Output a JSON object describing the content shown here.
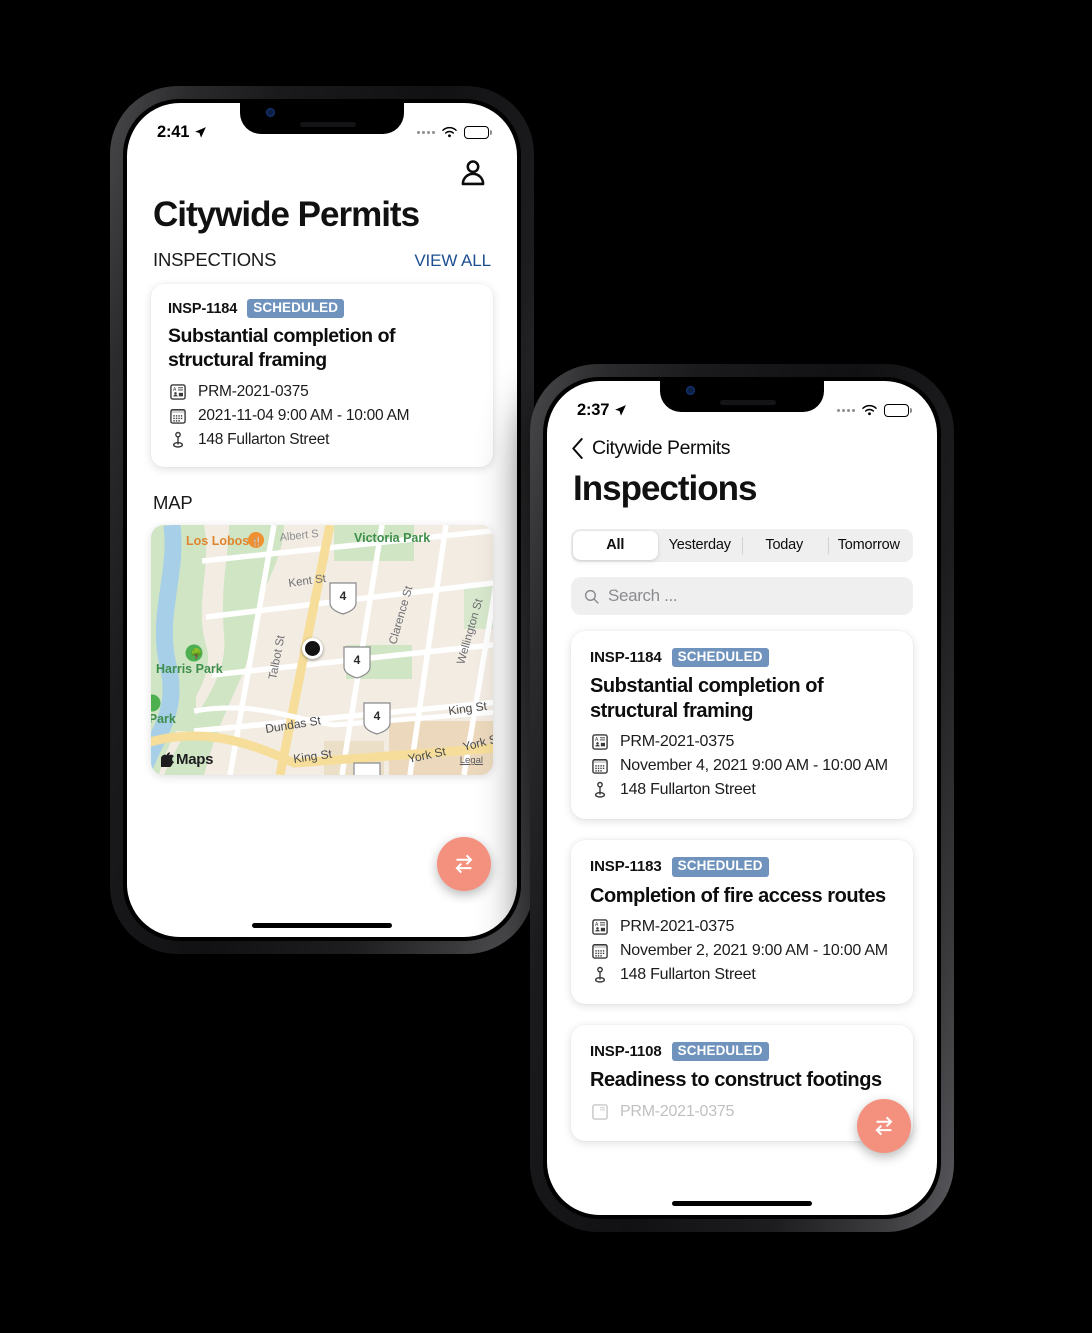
{
  "phone_home": {
    "status": {
      "time": "2:41",
      "location_icon": "location-arrow-icon",
      "wifi_icon": "wifi-icon",
      "battery_icon": "battery-charging-icon"
    },
    "avatar_icon": "person-icon",
    "title": "Citywide Permits",
    "section_label": "INSPECTIONS",
    "view_all_label": "VIEW ALL",
    "inspection": {
      "id": "INSP-1184",
      "status_badge": "SCHEDULED",
      "title": "Substantial completion of structural framing",
      "permit": "PRM-2021-0375",
      "datetime": "2021-11-04 9:00 AM - 10:00 AM",
      "address": "148 Fullarton Street"
    },
    "map_label": "MAP",
    "map": {
      "attribution": "Maps",
      "legal": "Legal",
      "places": [
        {
          "name": "Los Lobos",
          "type": "restaurant"
        },
        {
          "name": "Victoria Park",
          "type": "park"
        },
        {
          "name": "Harris Park",
          "type": "park"
        },
        {
          "name": "att Park",
          "type": "park"
        }
      ],
      "streets": [
        "Albert St",
        "Kent St",
        "Talbot St",
        "Clarence St",
        "Wellington St",
        "Dundas St",
        "King St",
        "York St"
      ],
      "highway_shield": "4"
    },
    "fab_icon": "sync-icon"
  },
  "phone_list": {
    "status": {
      "time": "2:37",
      "location_icon": "location-arrow-icon",
      "wifi_icon": "wifi-icon",
      "battery_icon": "battery-charging-icon"
    },
    "back_label": "Citywide Permits",
    "title": "Inspections",
    "segments": [
      {
        "label": "All",
        "selected": true
      },
      {
        "label": "Yesterday",
        "selected": false
      },
      {
        "label": "Today",
        "selected": false
      },
      {
        "label": "Tomorrow",
        "selected": false
      }
    ],
    "search": {
      "placeholder": "Search ...",
      "value": "",
      "icon": "search-icon"
    },
    "items": [
      {
        "id": "INSP-1184",
        "status_badge": "SCHEDULED",
        "title": "Substantial completion of structural framing",
        "permit": "PRM-2021-0375",
        "datetime": "November 4, 2021 9:00 AM - 10:00 AM",
        "address": "148 Fullarton Street"
      },
      {
        "id": "INSP-1183",
        "status_badge": "SCHEDULED",
        "title": "Completion of fire access routes",
        "permit": "PRM-2021-0375",
        "datetime": "November 2, 2021 9:00 AM - 10:00 AM",
        "address": "148 Fullarton Street"
      },
      {
        "id": "INSP-1108",
        "status_badge": "SCHEDULED",
        "title": "Readiness to construct footings",
        "permit": "PRM-2021-0375",
        "datetime": "",
        "address": ""
      }
    ],
    "fab_icon": "sync-icon"
  },
  "colors": {
    "badge_blue": "#6f93bd",
    "link_navy": "#1d4f91",
    "fab_coral": "#f4917e",
    "battery_green": "#30d158",
    "background": "#000000"
  }
}
